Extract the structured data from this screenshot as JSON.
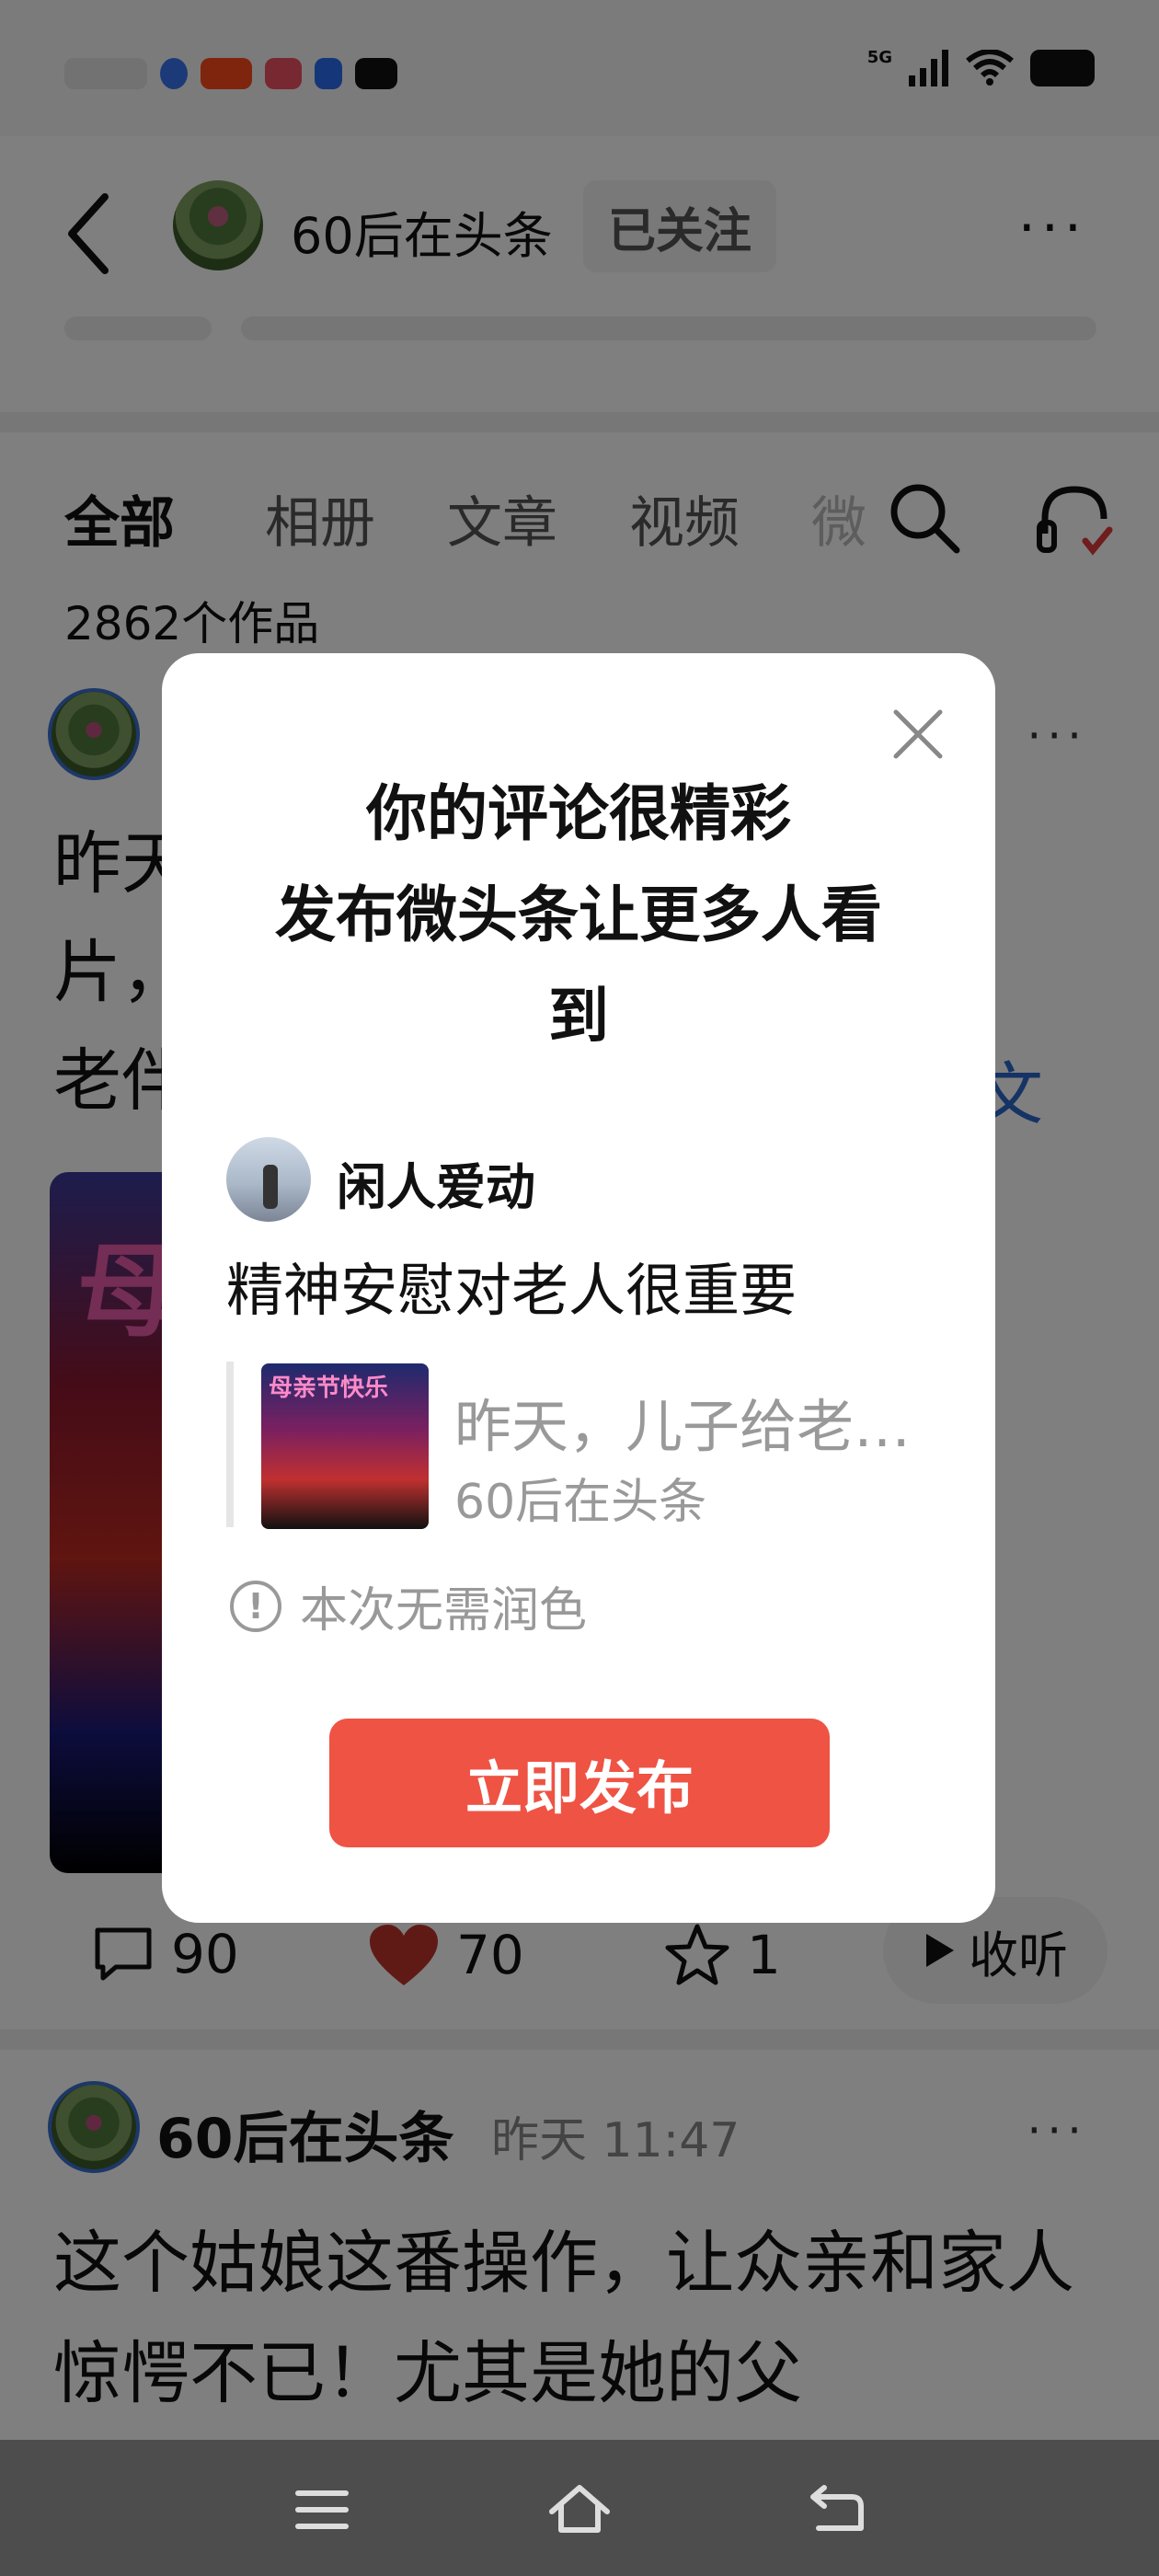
{
  "status_bar": {
    "network": "5G",
    "icons": [
      "signal-icon",
      "wifi-icon",
      "battery-icon"
    ]
  },
  "header": {
    "author_name": "60后在头条",
    "follow_label": "已关注",
    "more_label": "···"
  },
  "tabs": {
    "items": [
      {
        "label": "全部",
        "active": true
      },
      {
        "label": "相册",
        "active": false
      },
      {
        "label": "文章",
        "active": false
      },
      {
        "label": "视频",
        "active": false
      },
      {
        "label": "微",
        "active": false
      }
    ],
    "works_count": "2862个作品"
  },
  "post1": {
    "text_lines": [
      "昨天",
      "片，",
      "老伴"
    ],
    "link_fragment": "文",
    "image_text": "母",
    "more_label": "···",
    "actions": {
      "comments": "90",
      "likes": "70",
      "favorites": "1",
      "listen_label": "收听"
    }
  },
  "post2": {
    "author": "60后在头条",
    "time": "昨天  11:47",
    "more_label": "···",
    "text": "这个姑娘这番操作，让众亲和家人惊愕不已！尤其是她的父"
  },
  "modal": {
    "title_lines": [
      "你的评论很精彩",
      "发布微头条让更多人看",
      "到"
    ],
    "commenter_name": "闲人爱动",
    "comment_text": "精神安慰对老人很重要",
    "quote": {
      "thumb_text": "母亲节快乐",
      "title": "昨天，儿子给老…",
      "author": "60后在头条"
    },
    "hint": "本次无需润色",
    "publish_label": "立即发布"
  },
  "colors": {
    "publish_button": "#ee5344",
    "overlay": "rgba(0,0,0,0.5)",
    "link": "#2a66c8",
    "like_heart": "#c0342c"
  }
}
